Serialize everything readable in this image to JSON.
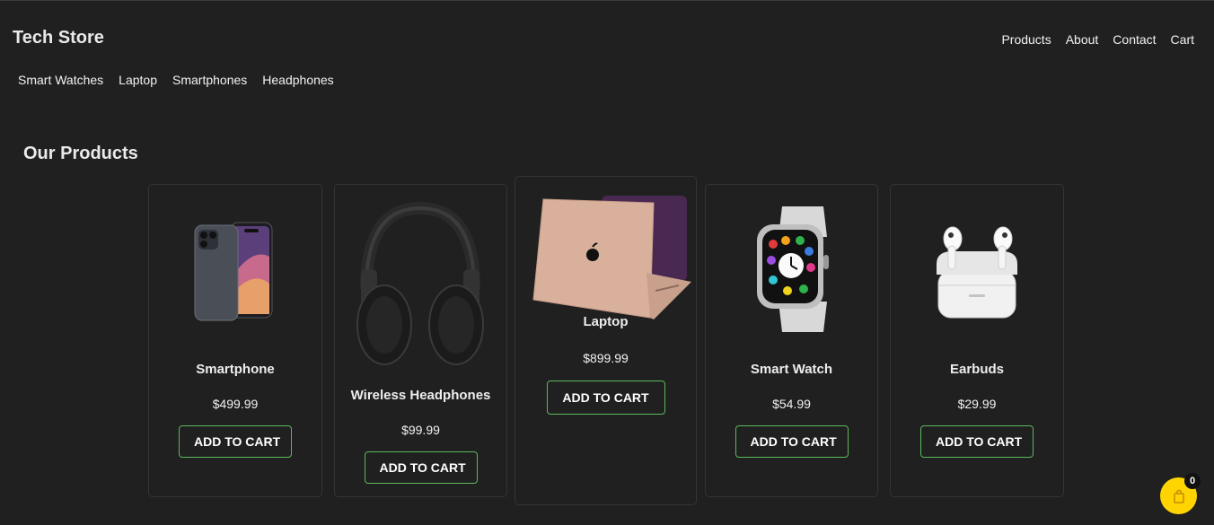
{
  "brand": "Tech Store",
  "nav": [
    "Products",
    "About",
    "Contact",
    "Cart"
  ],
  "categories": [
    "Smart Watches",
    "Laptop",
    "Smartphones",
    "Headphones"
  ],
  "section_title": "Our Products",
  "products": [
    {
      "name": "Smartphone",
      "price": "$499.99",
      "button": "ADD TO CART",
      "icon": "smartphone-image"
    },
    {
      "name": "Wireless Headphones",
      "price": "$99.99",
      "button": "ADD TO CART",
      "icon": "headphones-image"
    },
    {
      "name": "Laptop",
      "price": "$899.99",
      "button": "ADD TO CART",
      "icon": "laptop-image"
    },
    {
      "name": "Smart Watch",
      "price": "$54.99",
      "button": "ADD TO CART",
      "icon": "smartwatch-image"
    },
    {
      "name": "Earbuds",
      "price": "$29.99",
      "button": "ADD TO CART",
      "icon": "earbuds-image"
    }
  ],
  "cart_count": "0",
  "colors": {
    "background": "#202020",
    "button_border": "#5cb85c",
    "cart_bubble": "#ffd400"
  }
}
